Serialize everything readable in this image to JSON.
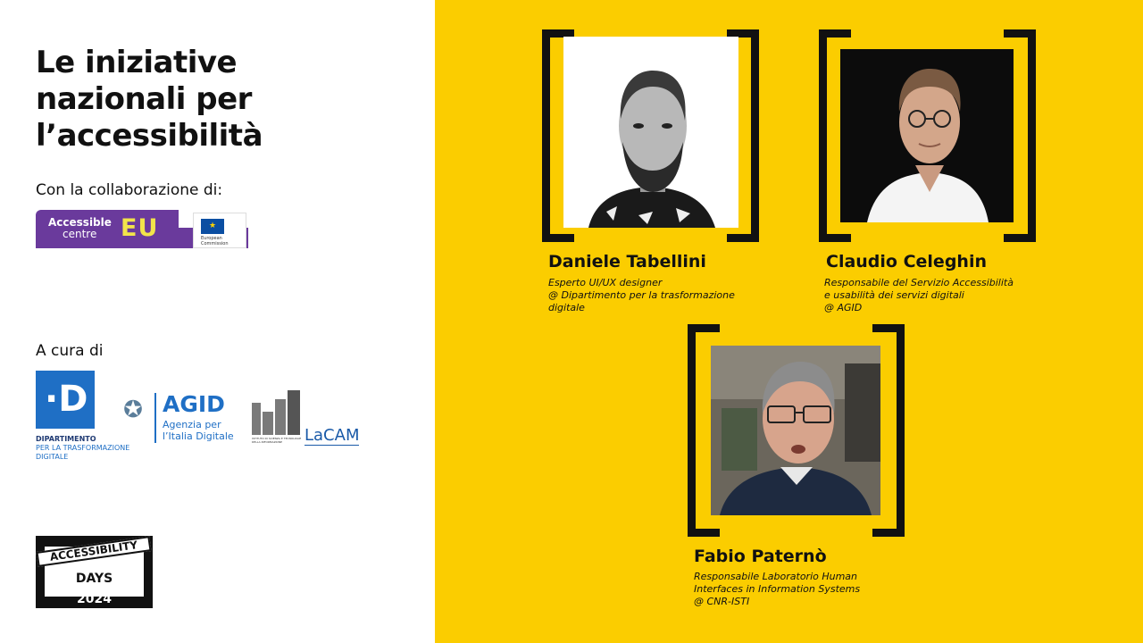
{
  "title": {
    "line1": "Le iniziative",
    "line2": "nazionali per",
    "line3": "l’accessibilità"
  },
  "collaboration_label": "Con la collaborazione di:",
  "accessible_eu": {
    "line1": "Accessible",
    "line2": "centre",
    "eu": "EU",
    "commission": "European Commission"
  },
  "curated_by_label": "A cura di",
  "logos": {
    "dtd": {
      "letter": "·D",
      "line1": "DIPARTIMENTO",
      "line2": "PER LA TRASFORMAZIONE DIGITALE"
    },
    "agid": {
      "name": "AGID",
      "sub1": "Agenzia per",
      "sub2": "l’Italia Digitale"
    },
    "isti": {
      "small": "ISTITUTO DI SCIENZA E TECNOLOGIE DELLA INFORMAZIONE",
      "lacam": "LaCAM"
    }
  },
  "event_logo": {
    "tape": "ACCESSIBILITY",
    "days": "DAYS",
    "year": "2024"
  },
  "speakers": [
    {
      "name": "Daniele Tabellini",
      "role_line1": "Esperto UI/UX designer",
      "role_line2": "@ Dipartimento per la trasformazione",
      "role_line3": "digitale"
    },
    {
      "name": "Claudio Celeghin",
      "role_line1": "Responsabile del Servizio Accessibilità",
      "role_line2": "e usabilità dei servizi digitali",
      "role_line3": "@ AGID"
    },
    {
      "name": "Fabio Paternò",
      "role_line1": "Responsabile Laboratorio Human",
      "role_line2": "Interfaces in Information Systems",
      "role_line3": "@ CNR-ISTI"
    }
  ],
  "colors": {
    "panel_yellow": "#fbcd00",
    "purple": "#6a3a9c",
    "agid_blue": "#1f6fc5"
  }
}
